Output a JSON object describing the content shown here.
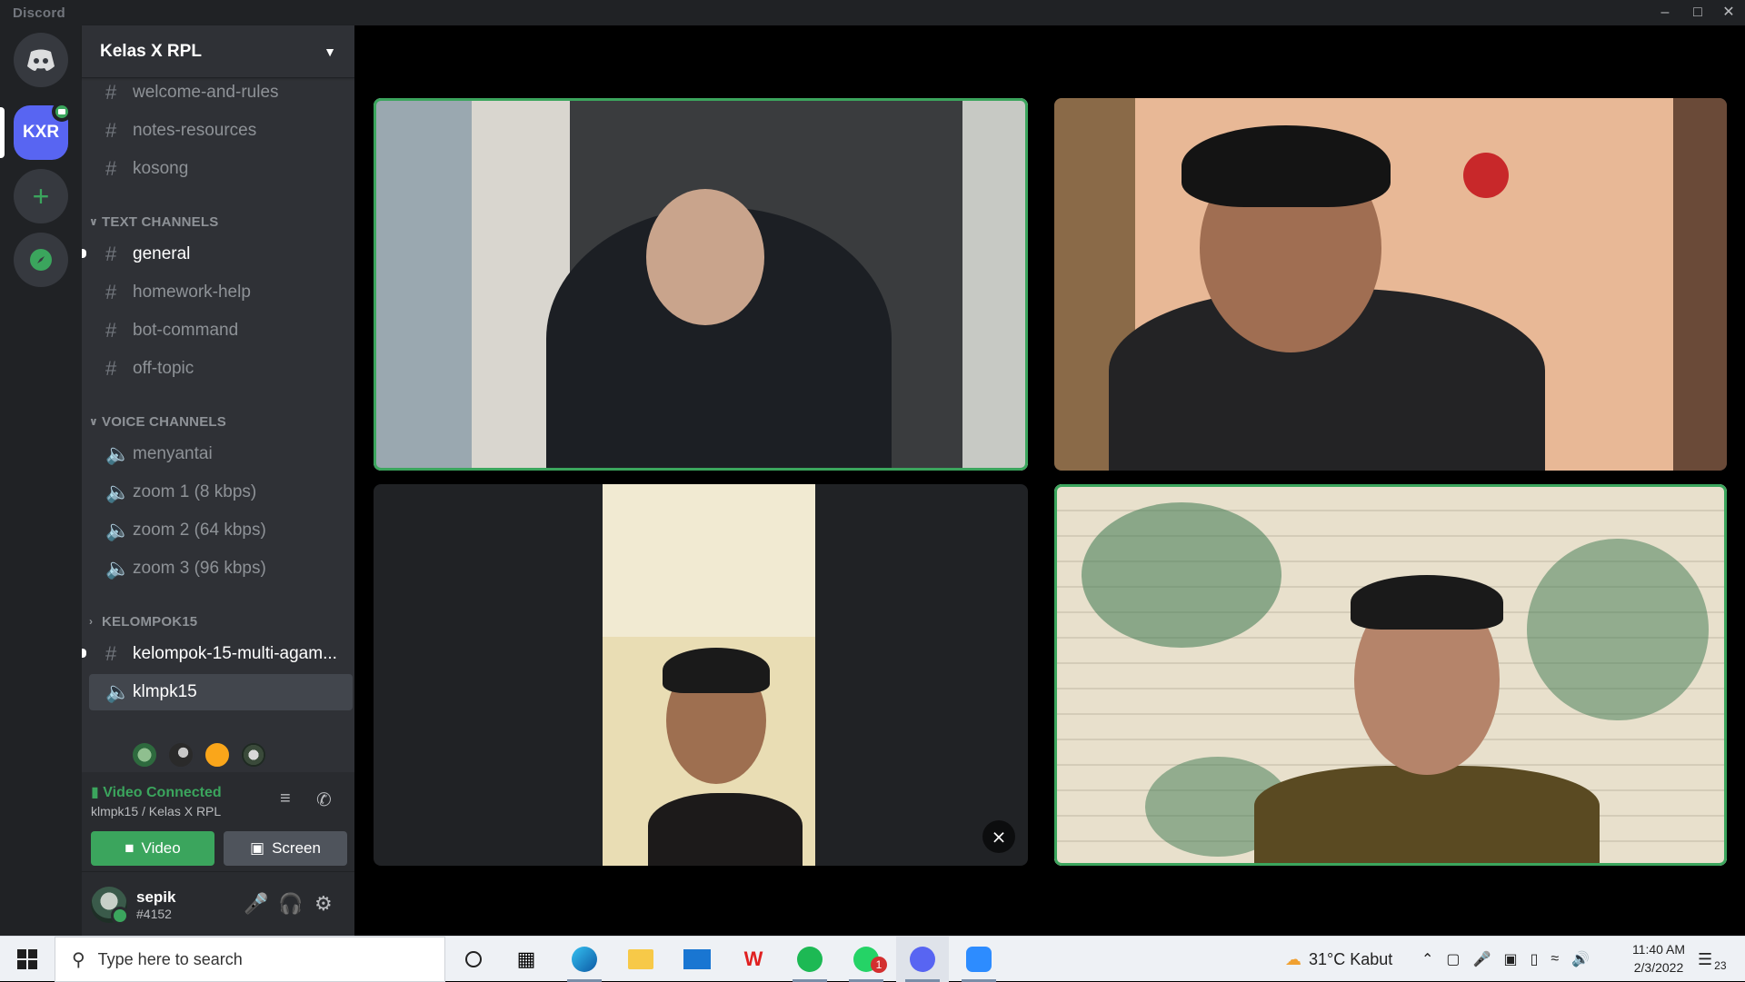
{
  "window": {
    "title": "Discord"
  },
  "server": {
    "name": "Kelas X RPL",
    "abbr": "KXR"
  },
  "channels_top": [
    {
      "name": "welcome-and-rules"
    },
    {
      "name": "notes-resources"
    },
    {
      "name": "kosong"
    }
  ],
  "text_category": "TEXT CHANNELS",
  "text_channels": [
    {
      "name": "general"
    },
    {
      "name": "homework-help"
    },
    {
      "name": "bot-command"
    },
    {
      "name": "off-topic"
    }
  ],
  "voice_category": "VOICE CHANNELS",
  "voice_channels": [
    {
      "name": "menyantai"
    },
    {
      "name": "zoom 1 (8 kbps)"
    },
    {
      "name": "zoom 2 (64 kbps)"
    },
    {
      "name": "zoom 3 (96 kbps)"
    }
  ],
  "group_category": "KELOMPOK15",
  "group_channels": [
    {
      "name": "kelompok-15-multi-agam..."
    },
    {
      "name": "klmpk15"
    }
  ],
  "voice_panel": {
    "status": "Video Connected",
    "location": "klmpk15 / Kelas X RPL",
    "video_label": "Video",
    "screen_label": "Screen"
  },
  "user": {
    "name": "sepik",
    "tag": "#4152"
  },
  "taskbar": {
    "search_placeholder": "Type here to search",
    "weather": "31°C  Kabut",
    "time": "11:40 AM",
    "date": "2/3/2022",
    "notification_count": "23",
    "whatsapp_badge": "1"
  },
  "colors": {
    "accent": "#5865f2",
    "green": "#3ba55d",
    "sidebar": "#2f3136",
    "rail": "#202225"
  }
}
